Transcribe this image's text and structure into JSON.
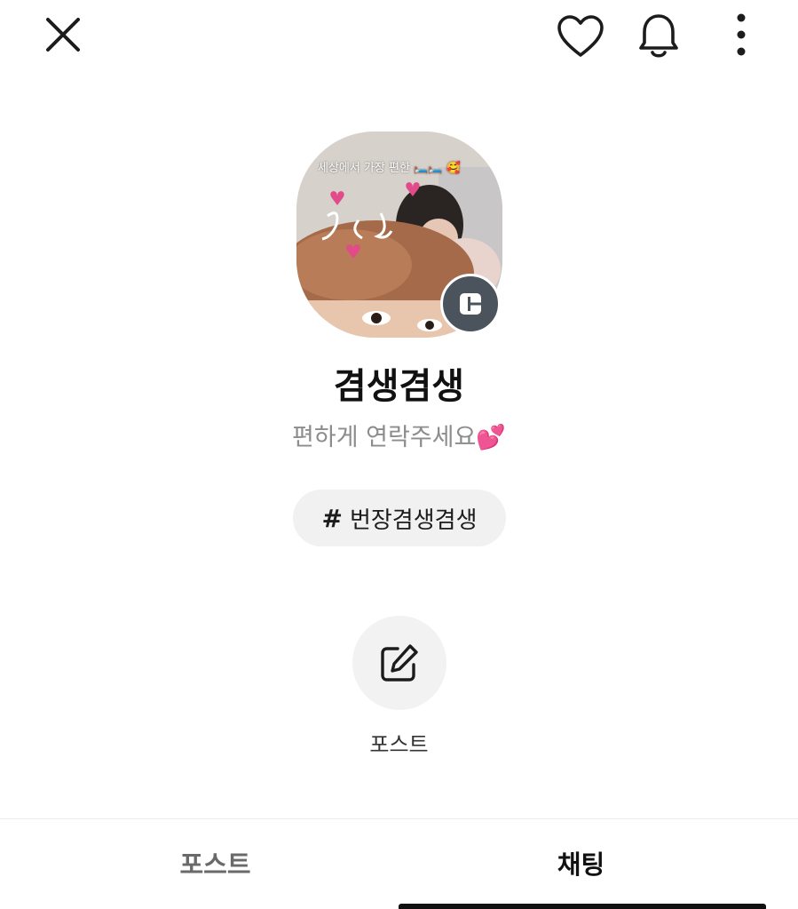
{
  "header": {
    "close_icon": "close-icon",
    "like_icon": "heart-icon",
    "notification_icon": "bell-icon",
    "more_icon": "more-vertical-icon"
  },
  "profile": {
    "avatar_caption": "세상에서 가장 편한 🛏️🛏️ 🥰",
    "badge_icon": "channel-icon",
    "name": "겸생겸생",
    "status_message": "편하게 연락주세요💕"
  },
  "hashtag": {
    "symbol": "#",
    "label": "번장겸생겸생"
  },
  "actions": {
    "post_icon": "edit-icon",
    "post_label": "포스트"
  },
  "tabs": [
    {
      "label": "포스트",
      "active": false
    },
    {
      "label": "채팅",
      "active": true
    }
  ],
  "colors": {
    "badge": "#4b545c",
    "chip_bg": "#f1f1f1",
    "active_tab": "#111111",
    "inactive_tab": "#6a6a6a"
  }
}
